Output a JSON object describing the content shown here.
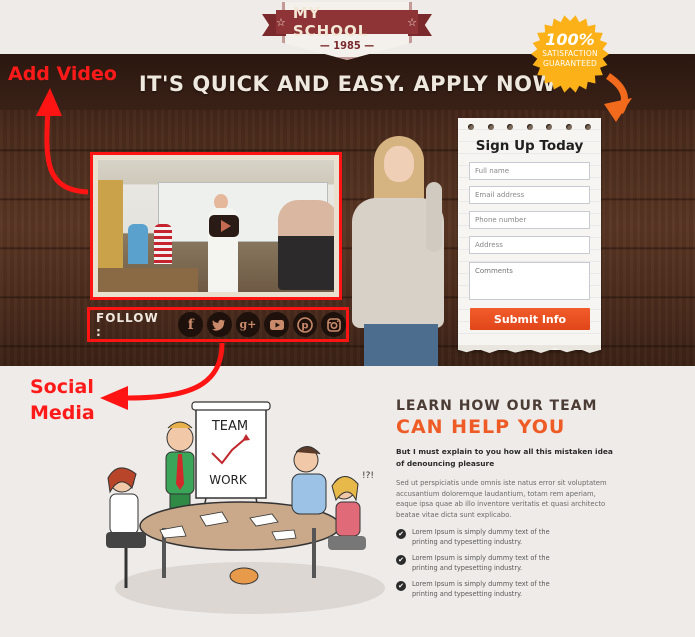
{
  "logo": {
    "name": "MY SCHOOL",
    "year": "1985",
    "star": "☆"
  },
  "hero": {
    "headline": "IT'S QUICK AND EASY. APPLY NOW"
  },
  "badge": {
    "percent": "100%",
    "line1": "SATISFACTION",
    "line2": "GUARANTEED",
    "color": "#fbb117"
  },
  "annotations": {
    "add_video": "Add Video",
    "social_line1": "Social",
    "social_line2": "Media",
    "color": "#ff1414"
  },
  "video": {
    "play_icon": "play-icon"
  },
  "follow": {
    "label": "FOLLOW :",
    "networks": [
      {
        "name": "facebook",
        "glyph": "f"
      },
      {
        "name": "twitter",
        "glyph": "bird"
      },
      {
        "name": "google-plus",
        "glyph": "g+"
      },
      {
        "name": "youtube",
        "glyph": "play"
      },
      {
        "name": "pinterest",
        "glyph": "p"
      },
      {
        "name": "instagram",
        "glyph": "camera"
      }
    ]
  },
  "form": {
    "title": "Sign Up Today",
    "full_name_placeholder": "Full name",
    "email_placeholder": "Email address",
    "phone_placeholder": "Phone number",
    "address_placeholder": "Address",
    "comments_placeholder": "Comments",
    "submit_label": "Submit Info",
    "accent": "#ef5423"
  },
  "illustration": {
    "board_line1": "TEAM",
    "board_line2": "WORK",
    "exclaim": "!?!"
  },
  "info": {
    "title_line1": "LEARN HOW OUR TEAM",
    "title_line2": "CAN HELP YOU",
    "lead": "But I must explain to you how all this mistaken idea of denouncing pleasure",
    "body": "Sed ut perspiciatis unde omnis iste natus error sit voluptatem accusantium doloremque laudantium, totam rem aperiam, eaque ipsa quae ab illo inventore veritatis et quasi architecto beatae vitae dicta sunt explicabo.",
    "bullets": [
      "Lorem Ipsum is simply dummy text of the printing and typesetting industry.",
      "Lorem Ipsum is simply dummy text of the printing and typesetting industry.",
      "Lorem Ipsum is simply dummy text of the printing and typesetting industry."
    ],
    "check_glyph": "✔"
  }
}
